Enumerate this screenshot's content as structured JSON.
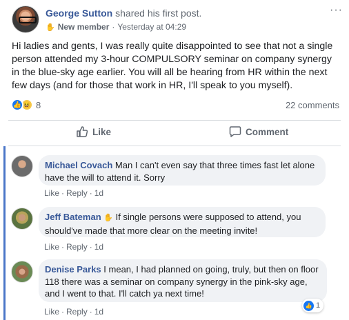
{
  "post": {
    "author": "George Sutton",
    "action": "shared his first post.",
    "badge": "New member",
    "timestamp": "Yesterday at 04:29",
    "more_label": "···",
    "text": "Hi ladies and gents, I was really quite disappointed to see that not a single person attended my 3-hour COMPULSORY seminar on company synergy in the blue-sky age earlier. You will all be hearing from HR within the next few days (and for those that work in HR, I'll speak to you myself).",
    "reactions": {
      "types": [
        "like-icon",
        "haha-icon"
      ],
      "count": "8"
    },
    "comments_count": "22 comments",
    "like_label": "Like",
    "comment_label": "Comment"
  },
  "comments": [
    {
      "author": "Michael Covach",
      "text": "Man I can't even say that three times fast let alone have the will to attend it. Sorry",
      "like_label": "Like",
      "reply_label": "Reply",
      "time": "1d"
    },
    {
      "author": "Jeff Bateman",
      "text": "If single persons were supposed to attend, you should've made that more clear on the meeting invite!",
      "like_label": "Like",
      "reply_label": "Reply",
      "time": "1d"
    },
    {
      "author": "Denise Parks",
      "text": "I mean, I had planned on going, truly, but then on floor 118 there was a seminar on company synergy in the pink-sky age, and I went to that. I'll catch ya next time!",
      "like_label": "Like",
      "reply_label": "Reply",
      "time": "1d",
      "reaction_count": "1"
    }
  ],
  "colors": {
    "link": "#385898",
    "meta": "#606770",
    "like_blue": "#1877f2",
    "bubble_bg": "#f0f2f5",
    "thread_bar": "#4a76c8"
  }
}
